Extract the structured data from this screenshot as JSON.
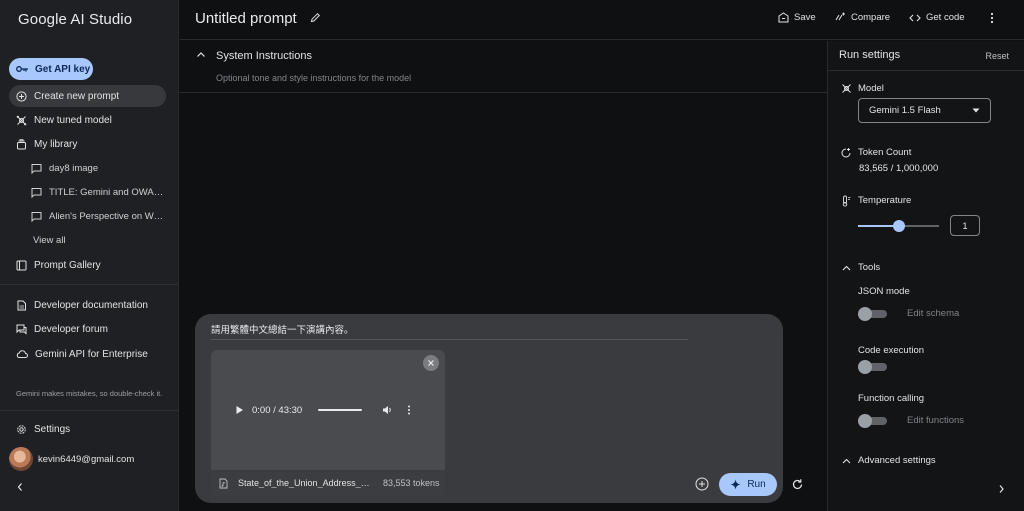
{
  "brand": "Google AI Studio",
  "sidebar": {
    "get_api_key": "Get API key",
    "items": [
      {
        "label": "Create new prompt"
      },
      {
        "label": "New tuned model"
      },
      {
        "label": "My library"
      }
    ],
    "library": [
      {
        "label": "day8 image"
      },
      {
        "label": "TITLE: Gemini and OWAS…"
      },
      {
        "label": "Alien's Perspective on We…"
      }
    ],
    "view_all": "View all",
    "prompt_gallery": "Prompt Gallery",
    "links": [
      {
        "label": "Developer documentation"
      },
      {
        "label": "Developer forum"
      },
      {
        "label": "Gemini API for Enterprise"
      }
    ],
    "disclaimer": "Gemini makes mistakes, so double-check it.",
    "settings": "Settings",
    "user_email": "kevin6449@gmail.com"
  },
  "topbar": {
    "title": "Untitled prompt",
    "save": "Save",
    "compare": "Compare",
    "get_code": "Get code"
  },
  "system_instructions": {
    "title": "System Instructions",
    "placeholder": "Optional tone and style instructions for the model"
  },
  "composer": {
    "prompt": "請用繁體中文總結一下演講內容。",
    "media": {
      "time": "0:00 / 43:30",
      "file_name": "State_of_the_Union_Address_…",
      "tokens": "83,553 tokens"
    },
    "run": "Run"
  },
  "run_settings": {
    "title": "Run settings",
    "reset": "Reset",
    "model_label": "Model",
    "model_value": "Gemini 1.5 Flash",
    "token_label": "Token Count",
    "token_value": "83,565 / 1,000,000",
    "temperature_label": "Temperature",
    "temperature_value": "1",
    "temperature_fraction": 0.5,
    "tools_label": "Tools",
    "json_mode": "JSON mode",
    "edit_schema": "Edit schema",
    "code_execution": "Code execution",
    "function_calling": "Function calling",
    "edit_functions": "Edit functions",
    "advanced": "Advanced settings"
  },
  "colors": {
    "accent": "#a8c7fa",
    "background": "#0f1012",
    "sidebar": "#1f2023",
    "composer": "#3a3b3e"
  }
}
